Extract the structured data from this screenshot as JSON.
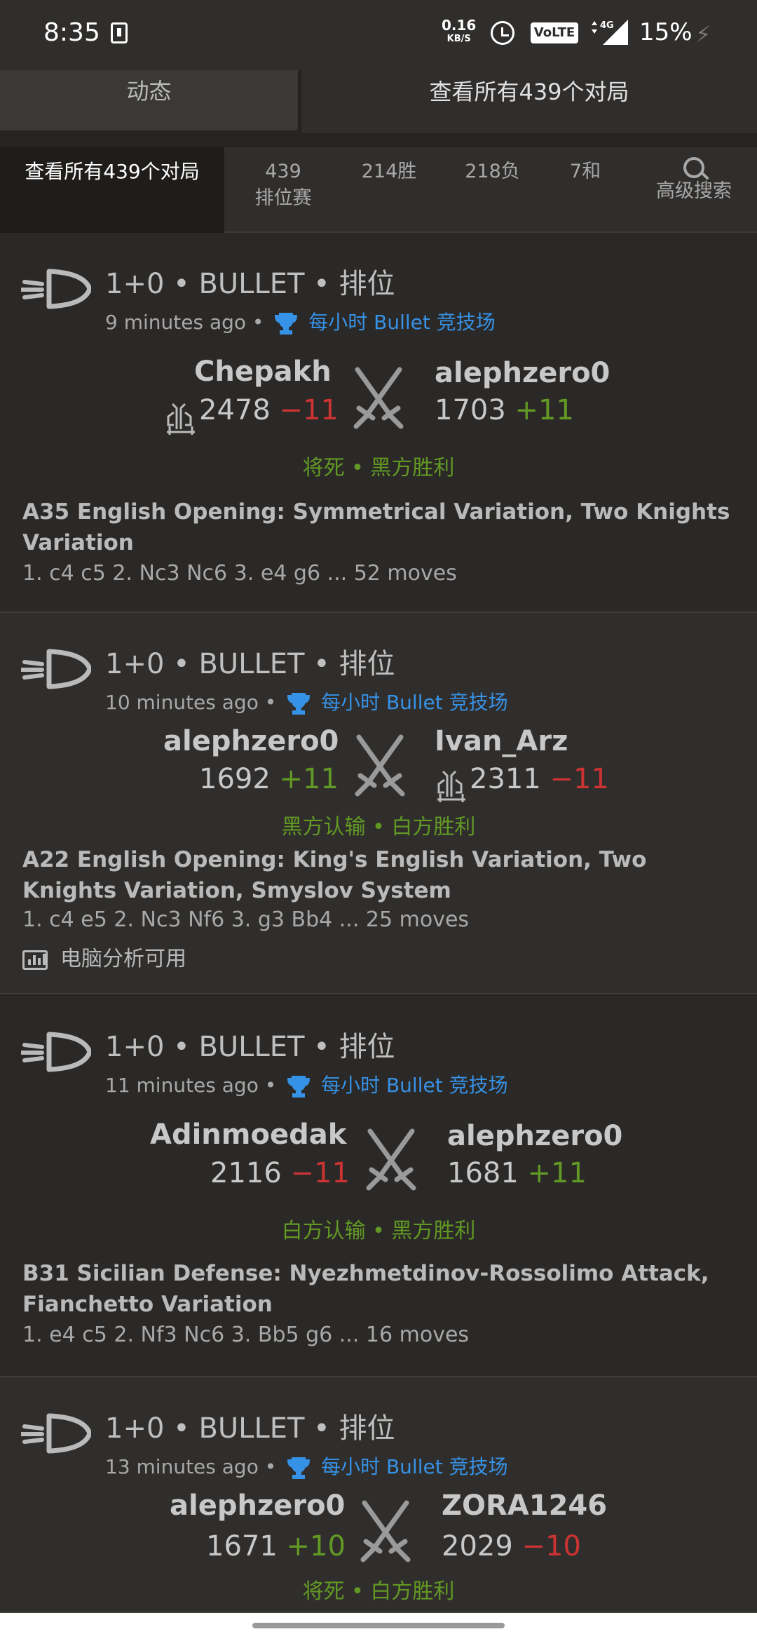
{
  "status_bar": {
    "time": "8:35",
    "speed_value": "0.16",
    "speed_unit": "KB/S",
    "volte": "VoLTE",
    "network": "4G",
    "battery": "15%"
  },
  "tabs": [
    "动态",
    "查看所有439个对局"
  ],
  "filters": {
    "all": "查看所有439个对局",
    "rated_count": "439",
    "rated_label": "排位赛",
    "wins": "214胜",
    "losses": "218负",
    "draws": "7和",
    "search": "高级搜索"
  },
  "games": [
    {
      "title": "1+0 • BULLET • 排位",
      "time_ago": "9 minutes ago •",
      "tournament": "每小时 Bullet 竞技场",
      "white": {
        "name": "Chepakh",
        "rating": "2478",
        "diff": "−11",
        "tournament_icon": true
      },
      "black": {
        "name": "alephzero0",
        "rating": "1703",
        "diff": "+11"
      },
      "result": "将死 • 黑方胜利",
      "opening": "A35 English Opening: Symmetrical Variation, Two Knights Variation",
      "moves": "1. c4 c5 2. Nc3 Nc6 3. e4 g6 ... 52 moves"
    },
    {
      "title": "1+0 • BULLET • 排位",
      "time_ago": "10 minutes ago •",
      "tournament": "每小时 Bullet 竞技场",
      "white": {
        "name": "alephzero0",
        "rating": "1692",
        "diff": "+11"
      },
      "black": {
        "name": "Ivan_Arz",
        "rating": "2311",
        "diff": "−11",
        "tournament_icon": true
      },
      "result": "黑方认输 • 白方胜利",
      "opening": "A22 English Opening: King's English Variation, Two Knights Variation, Smyslov System",
      "moves": "1. c4 e5 2. Nc3 Nf6 3. g3 Bb4 ... 25 moves",
      "analysis": "电脑分析可用"
    },
    {
      "title": "1+0 • BULLET • 排位",
      "time_ago": "11 minutes ago •",
      "tournament": "每小时 Bullet 竞技场",
      "white": {
        "name": "Adinmoedak",
        "rating": "2116",
        "diff": "−11"
      },
      "black": {
        "name": "alephzero0",
        "rating": "1681",
        "diff": "+11"
      },
      "result": "白方认输 • 黑方胜利",
      "opening": "B31 Sicilian Defense: Nyezhmetdinov-Rossolimo Attack, Fianchetto Variation",
      "moves": "1. e4 c5 2. Nf3 Nc6 3. Bb5 g6 ... 16 moves"
    },
    {
      "title": "1+0 • BULLET • 排位",
      "time_ago": "13 minutes ago •",
      "tournament": "每小时 Bullet 竞技场",
      "white": {
        "name": "alephzero0",
        "rating": "1671",
        "diff": "+10"
      },
      "black": {
        "name": "ZORA1246",
        "rating": "2029",
        "diff": "−10"
      },
      "result": "将死 • 白方胜利"
    }
  ],
  "colors": {
    "win": "#629924",
    "loss": "#cc3333",
    "link": "#3692e7",
    "background": "#262421"
  },
  "icons": [
    "bullet-icon",
    "trophy-icon",
    "swords-icon",
    "tournament-player-icon",
    "search-icon",
    "analysis-chart-icon"
  ]
}
